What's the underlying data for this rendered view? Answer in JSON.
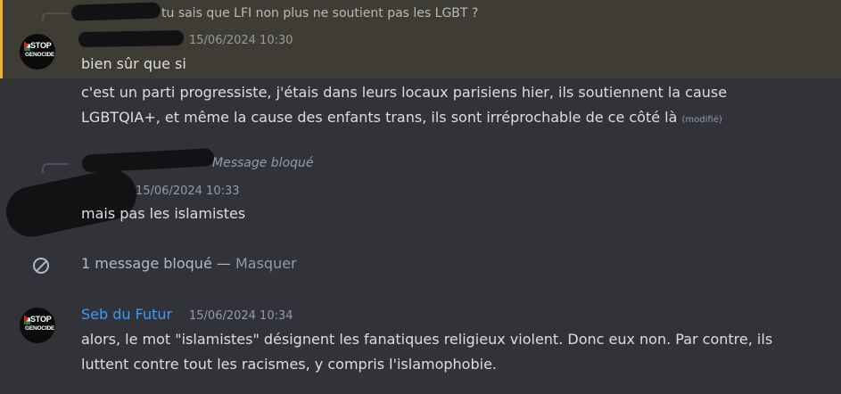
{
  "messages": [
    {
      "reply": {
        "text": "tu sais que LFI non plus ne soutient pas les LGBT ?"
      },
      "timestamp": "15/06/2024 10:30",
      "lines": [
        "bien sûr que si"
      ]
    },
    {
      "lines": [
        "c'est un parti progressiste, j'étais dans leurs locaux parisiens hier, ils soutiennent la cause",
        "LGBTQIA+, et même la cause des enfants trans, ils sont irréprochable de ce côté là"
      ],
      "edited": "(modifié)"
    },
    {
      "reply": {
        "text": "Message bloqué"
      },
      "timestamp": "15/06/2024 10:33",
      "lines": [
        "mais pas les islamistes"
      ]
    },
    {
      "username": "Seb du Futur",
      "timestamp": "15/06/2024 10:34",
      "lines": [
        "alors, le mot \"islamistes\" désignent les fanatiques religieux violent. Donc eux non. Par contre, ils",
        "luttent contre tout les racismes, y compris l'islamophobie."
      ]
    }
  ],
  "blocked": {
    "text": "1 message bloqué — ",
    "hide_label": "Masquer"
  },
  "avatar": {
    "line1": "STOP",
    "line2": "GENOCIDE"
  },
  "colors": {
    "background": "#313338",
    "highlight": "#3f3c33",
    "highlight_bar": "#f0b232",
    "username": "#3a9bfc"
  }
}
